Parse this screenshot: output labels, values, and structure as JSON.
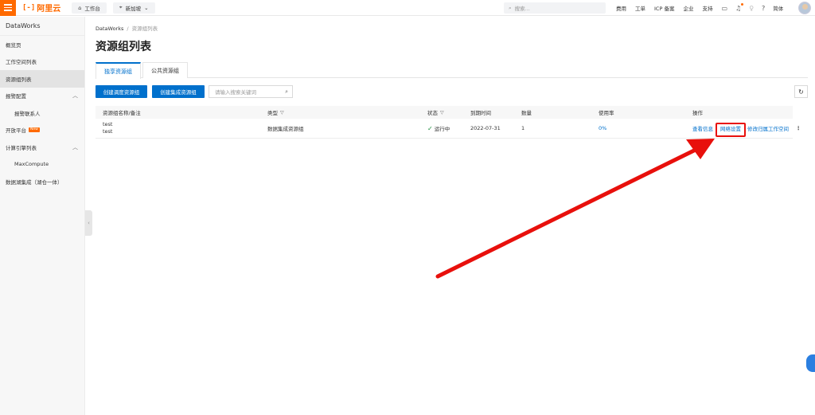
{
  "topbar": {
    "logo_mark": "[-]",
    "logo_text": "阿里云",
    "workbench": "工作台",
    "region": "新加坡",
    "search_placeholder": "搜索...",
    "links": [
      "费用",
      "工单",
      "ICP 备案",
      "企业",
      "支持"
    ],
    "lang": "简体"
  },
  "sidebar": {
    "title": "DataWorks",
    "items": [
      {
        "label": "概览页"
      },
      {
        "label": "工作空间列表"
      },
      {
        "label": "资源组列表"
      },
      {
        "label": "报警配置"
      },
      {
        "label": "报警联系人"
      },
      {
        "label": "开放平台"
      },
      {
        "label": "计算引擎列表"
      },
      {
        "label": "MaxCompute"
      },
      {
        "label": "数据湖集成（湖仓一体）"
      }
    ],
    "new_badge": "New"
  },
  "main": {
    "breadcrumb": {
      "root": "DataWorks",
      "sep": "/",
      "current": "资源组列表"
    },
    "title": "资源组列表",
    "tabs": [
      "独享资源组",
      "公共资源组"
    ],
    "buttons": {
      "create_schedule": "创建调度资源组",
      "create_integration": "创建集成资源组"
    },
    "search_placeholder": "请输入搜索关键词",
    "table": {
      "headers": [
        "资源组名称/备注",
        "类型",
        "状态",
        "到期时间",
        "数量",
        "使用率",
        "操作"
      ],
      "rows": [
        {
          "name": "test",
          "remark": "test",
          "type": "数据集成资源组",
          "status": "运行中",
          "expire": "2022-07-31",
          "count": "1",
          "usage": "0%",
          "actions": [
            "查看信息",
            "网络设置",
            "修改归属工作空间"
          ]
        }
      ]
    }
  },
  "colors": {
    "accent": "#0070cc",
    "brand": "#ff6a00",
    "highlight": "#e8100c"
  }
}
